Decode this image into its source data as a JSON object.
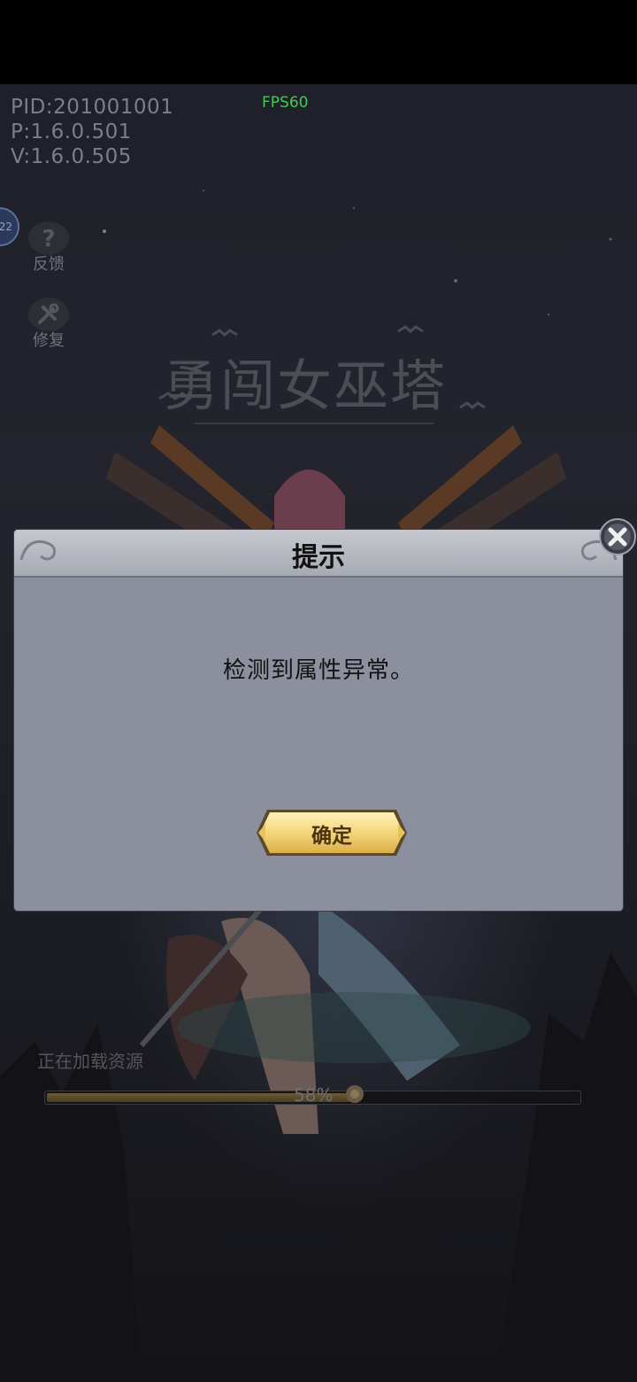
{
  "debug": {
    "pid": "PID:201001001",
    "p_version": "P:1.6.0.501",
    "v_version": "V:1.6.0.505",
    "fps": "FPS60"
  },
  "side_menu": {
    "badge_count": "22",
    "feedback_label": "反馈",
    "repair_label": "修复"
  },
  "game": {
    "logo_title": "勇闯女巫塔"
  },
  "loading": {
    "status_text": "正在加载资源",
    "progress_percent": 58,
    "progress_label": "58%"
  },
  "dialog": {
    "title": "提示",
    "message": "检测到属性异常。",
    "confirm_label": "确定"
  },
  "colors": {
    "dialog_body": "#8c909e",
    "dialog_header": "#b8bbc3",
    "button_gold": "#f3d98a",
    "fps_green": "#39d24a"
  }
}
